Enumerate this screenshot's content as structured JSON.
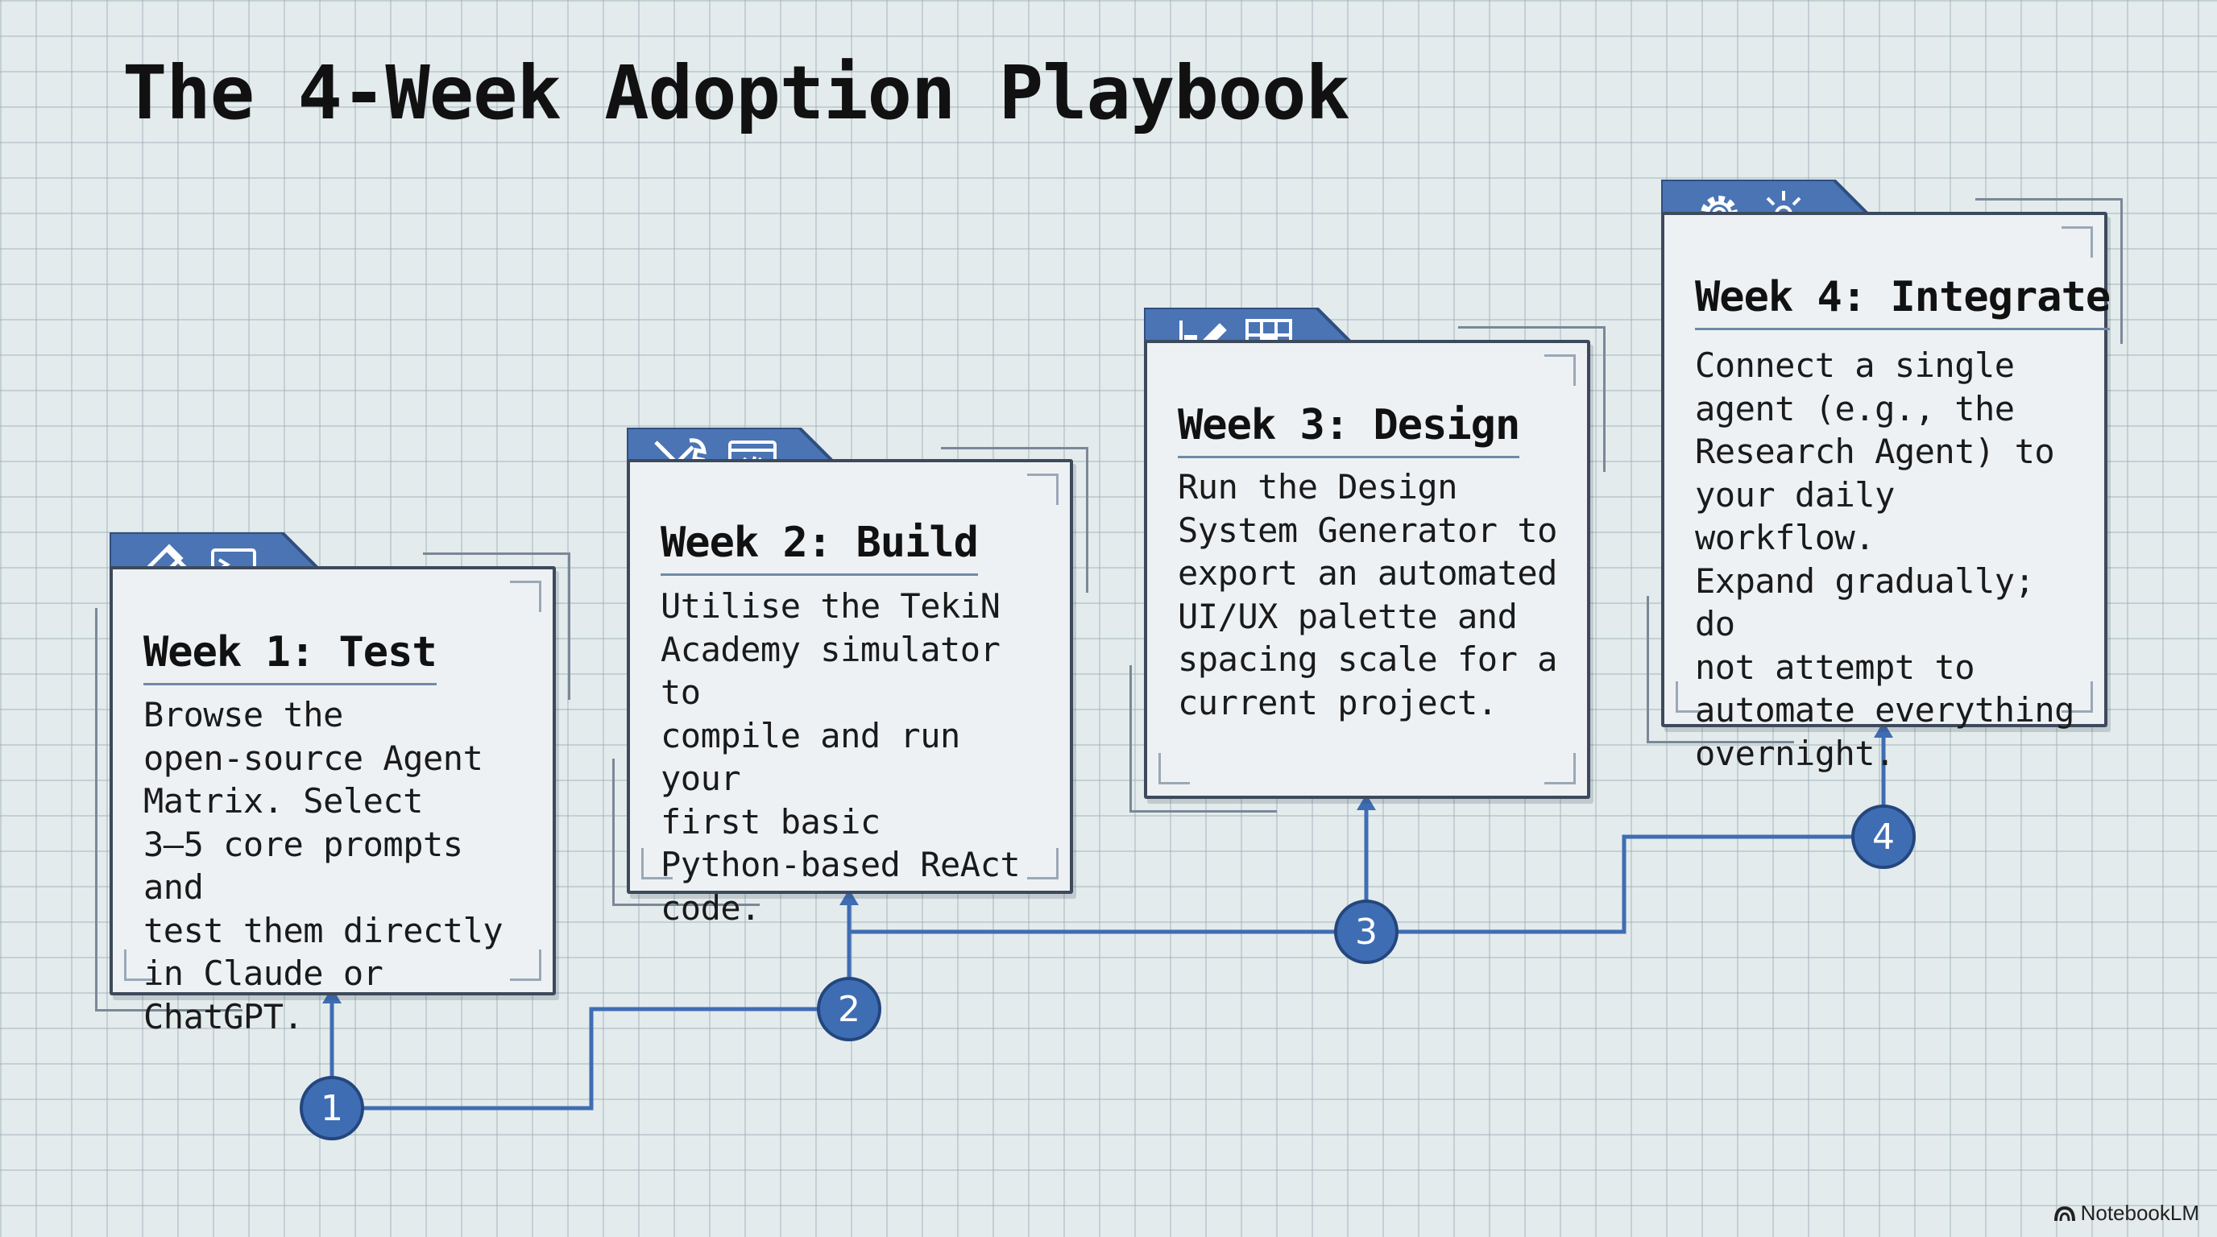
{
  "title": "The 4-Week Adoption Playbook",
  "colors": {
    "accent": "#3f6db3",
    "line": "#3f6db3",
    "card_border": "#3d4a5c",
    "grid_bg": "#e3ebec"
  },
  "steps": [
    {
      "number": "1",
      "title": "Week 1: Test",
      "body": "Browse the\nopen-source Agent\nMatrix. Select\n3–5 core prompts and\ntest them directly\nin Claude or ChatGPT.",
      "icons": [
        "test-tube-icon",
        "terminal-icon"
      ]
    },
    {
      "number": "2",
      "title": "Week 2: Build",
      "body": "Utilise the TekiN\nAcademy simulator to\ncompile and run your\nfirst basic\nPython-based ReAct\ncode.",
      "icons": [
        "tools-icon",
        "code-window-icon"
      ]
    },
    {
      "number": "3",
      "title": "Week 3: Design",
      "body": "Run the Design\nSystem Generator to\nexport an automated\nUI/UX palette and\nspacing scale for a\ncurrent project.",
      "icons": [
        "design-pencil-icon",
        "grid-icon"
      ]
    },
    {
      "number": "4",
      "title": "Week 4: Integrate",
      "body": "Connect a single\nagent (e.g., the\nResearch Agent) to\nyour daily workflow.\nExpand gradually; do\nnot attempt to\nautomate everything\novernight.",
      "icons": [
        "gear-icon",
        "sparkle-gear-icon"
      ]
    }
  ],
  "brand": "NotebookLM"
}
